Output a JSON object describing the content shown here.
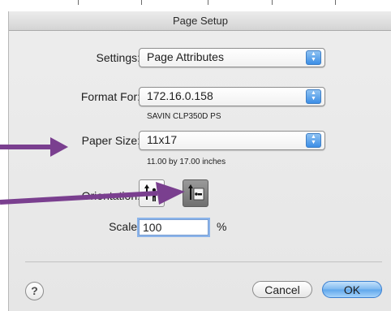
{
  "window": {
    "title": "Page Setup"
  },
  "settings": {
    "label": "Settings:",
    "value": "Page Attributes"
  },
  "format_for": {
    "label": "Format For:",
    "value": "172.16.0.158",
    "description": "SAVIN CLP350D PS"
  },
  "paper_size": {
    "label": "Paper Size:",
    "value": "11x17",
    "dimensions": "11.00 by 17.00 inches"
  },
  "orientation": {
    "label": "Orientation:",
    "options": [
      "portrait",
      "landscape"
    ],
    "selected": "landscape"
  },
  "scale": {
    "label": "Scale:",
    "value": "100",
    "unit": "%"
  },
  "buttons": {
    "help": "?",
    "cancel": "Cancel",
    "ok": "OK"
  },
  "colors": {
    "annotation_arrow": "#7a3f8f",
    "default_button": "#5fa6ec",
    "popup_arrows": "#3c8ee6"
  }
}
